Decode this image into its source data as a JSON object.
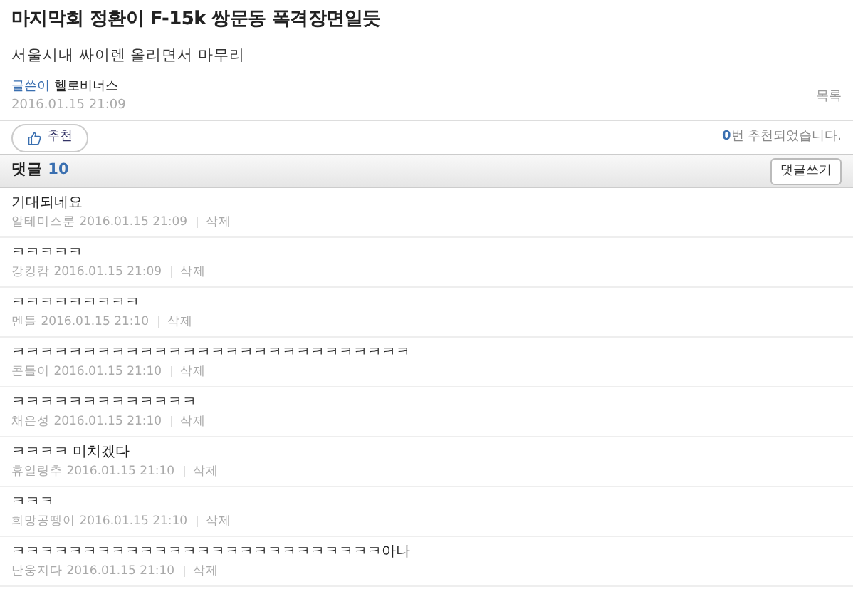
{
  "post": {
    "title": "마지막회 정환이 F-15k 쌍문동 폭격장면일듯",
    "body": "서울시내 싸이렌 올리면서 마무리",
    "author_label": "글쓴이",
    "author": "헬로비너스",
    "date": "2016.01.15 21:09",
    "list_link": "목록"
  },
  "recommend": {
    "button": "추천",
    "count": "0",
    "count_text": "번 추천되었습니다."
  },
  "comments_header": {
    "label": "댓글",
    "count": "10",
    "write_button": "댓글쓰기"
  },
  "comments": [
    {
      "text": "기대되네요",
      "author": "알테미스룬",
      "date": "2016.01.15 21:09",
      "delete": "삭제"
    },
    {
      "text": "ㅋㅋㅋㅋㅋ",
      "author": "강킹캄",
      "date": "2016.01.15 21:09",
      "delete": "삭제"
    },
    {
      "text": "ㅋㅋㅋㅋㅋㅋㅋㅋㅋ",
      "author": "멘들",
      "date": "2016.01.15 21:10",
      "delete": "삭제"
    },
    {
      "text": "ㅋㅋㅋㅋㅋㅋㅋㅋㅋㅋㅋㅋㅋㅋㅋㅋㅋㅋㅋㅋㅋㅋㅋㅋㅋㅋㅋㅋ",
      "author": "콘들이",
      "date": "2016.01.15 21:10",
      "delete": "삭제"
    },
    {
      "text": "ㅋㅋㅋㅋㅋㅋㅋㅋㅋㅋㅋㅋㅋ",
      "author": "채은성",
      "date": "2016.01.15 21:10",
      "delete": "삭제"
    },
    {
      "text": "ㅋㅋㅋㅋ 미치겠다",
      "author": "휴일링추",
      "date": "2016.01.15 21:10",
      "delete": "삭제"
    },
    {
      "text": "ㅋㅋㅋ",
      "author": "희망공뗑이",
      "date": "2016.01.15 21:10",
      "delete": "삭제"
    },
    {
      "text": "ㅋㅋㅋㅋㅋㅋㅋㅋㅋㅋㅋㅋㅋㅋㅋㅋㅋㅋㅋㅋㅋㅋㅋㅋㅋㅋ아나",
      "author": "난웅지다",
      "date": "2016.01.15 21:10",
      "delete": "삭제"
    }
  ]
}
